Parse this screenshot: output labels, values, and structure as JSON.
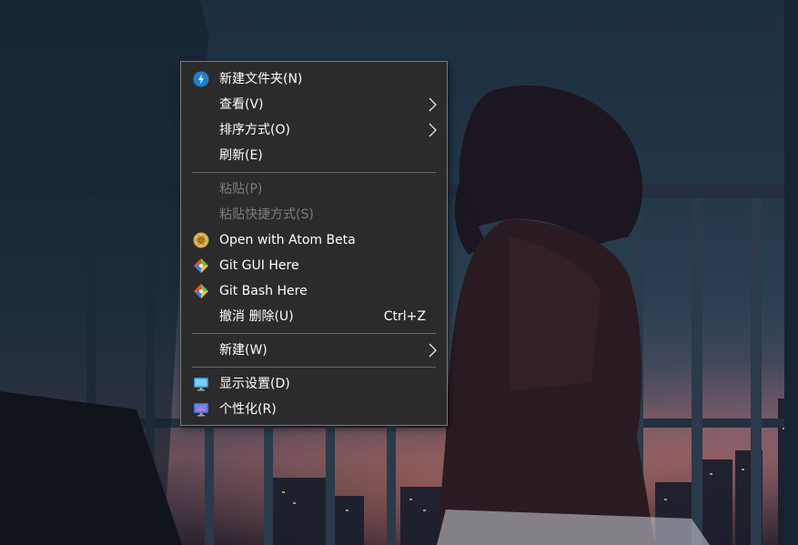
{
  "menu": {
    "items": [
      {
        "label": "新建文件夹(N)",
        "icon": "bitwarden-send-icon",
        "disabled": false
      },
      {
        "label": "查看(V)",
        "submenu": true,
        "disabled": false
      },
      {
        "label": "排序方式(O)",
        "submenu": true,
        "disabled": false
      },
      {
        "label": "刷新(E)",
        "disabled": false
      },
      {
        "label": "粘贴(P)",
        "disabled": true
      },
      {
        "label": "粘贴快捷方式(S)",
        "disabled": true
      },
      {
        "label": "Open with Atom Beta",
        "icon": "atom-beta-icon",
        "disabled": false
      },
      {
        "label": "Git GUI Here",
        "icon": "git-icon",
        "disabled": false
      },
      {
        "label": "Git Bash Here",
        "icon": "git-icon",
        "disabled": false
      },
      {
        "label": "撤消 删除(U)",
        "shortcut": "Ctrl+Z",
        "disabled": false
      },
      {
        "label": "新建(W)",
        "submenu": true,
        "disabled": false
      },
      {
        "label": "显示设置(D)",
        "icon": "display-settings-icon",
        "disabled": false
      },
      {
        "label": "个性化(R)",
        "icon": "personalize-icon",
        "disabled": false
      }
    ]
  },
  "colors": {
    "menu_bg": "#2b2b2b",
    "menu_border": "#7a7a7a",
    "text": "#ffffff",
    "text_disabled": "#7c7c7c",
    "separator": "#6a6a6a"
  }
}
